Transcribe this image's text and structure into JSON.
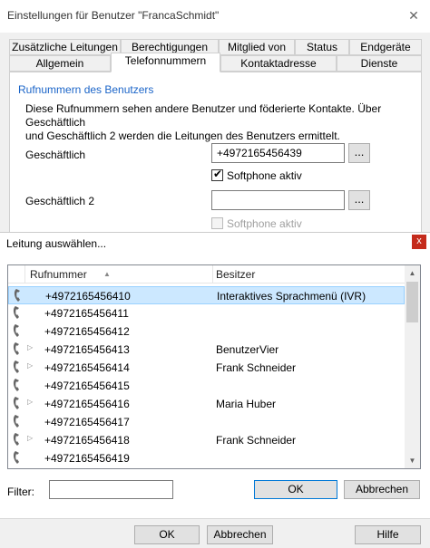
{
  "main_dialog": {
    "title": "Einstellungen für Benutzer \"FrancaSchmidt\"",
    "close_glyph": "✕",
    "tabs_row1": [
      "Zusätzliche Leitungen",
      "Berechtigungen",
      "Mitglied von",
      "Status",
      "Endgeräte"
    ],
    "tabs_row2": [
      "Allgemein",
      "Telefonnummern",
      "Kontaktadresse",
      "Dienste"
    ],
    "active_tab": "Telefonnummern",
    "section_heading": "Rufnummern des Benutzers",
    "description_line1": "Diese Rufnummern sehen andere Benutzer und föderierte Kontakte. Über Geschäftlich",
    "description_line2": "und Geschäftlich 2 werden die Leitungen des Benutzers ermittelt.",
    "fields": [
      {
        "label": "Geschäftlich",
        "value": "+4972165456439",
        "browse_label": "...",
        "softphone_label": "Softphone aktiv",
        "softphone_checked": true
      },
      {
        "label": "Geschäftlich 2",
        "value": "",
        "browse_label": "...",
        "softphone_label": "Softphone aktiv",
        "softphone_checked": false
      }
    ],
    "buttons": {
      "ok": "OK",
      "cancel": "Abbrechen",
      "help": "Hilfe"
    }
  },
  "select_dialog": {
    "title": "Leitung auswählen...",
    "close_glyph": "x",
    "columns": {
      "number": "Rufnummer",
      "owner": "Besitzer"
    },
    "sort_glyph": "▲",
    "rows": [
      {
        "number": "+4972165456410",
        "owner": "Interaktives Sprachmenü (IVR)",
        "expandable": false,
        "selected": true
      },
      {
        "number": "+4972165456411",
        "owner": "",
        "expandable": false,
        "selected": false
      },
      {
        "number": "+4972165456412",
        "owner": "",
        "expandable": false,
        "selected": false
      },
      {
        "number": "+4972165456413",
        "owner": "BenutzerVier",
        "expandable": true,
        "selected": false
      },
      {
        "number": "+4972165456414",
        "owner": "Frank Schneider",
        "expandable": true,
        "selected": false
      },
      {
        "number": "+4972165456415",
        "owner": "",
        "expandable": false,
        "selected": false
      },
      {
        "number": "+4972165456416",
        "owner": "Maria Huber",
        "expandable": true,
        "selected": false
      },
      {
        "number": "+4972165456417",
        "owner": "",
        "expandable": false,
        "selected": false
      },
      {
        "number": "+4972165456418",
        "owner": "Frank Schneider",
        "expandable": true,
        "selected": false
      },
      {
        "number": "+4972165456419",
        "owner": "",
        "expandable": false,
        "selected": false
      }
    ],
    "filter_label": "Filter:",
    "filter_value": "",
    "buttons": {
      "ok": "OK",
      "cancel": "Abbrechen"
    },
    "icons": {
      "row": "phone-handset-icon",
      "expander": "expand-arrow-icon"
    }
  },
  "colors": {
    "accent": "#1a64c8",
    "selection": "#cce8ff",
    "close_red": "#c42b1c"
  }
}
